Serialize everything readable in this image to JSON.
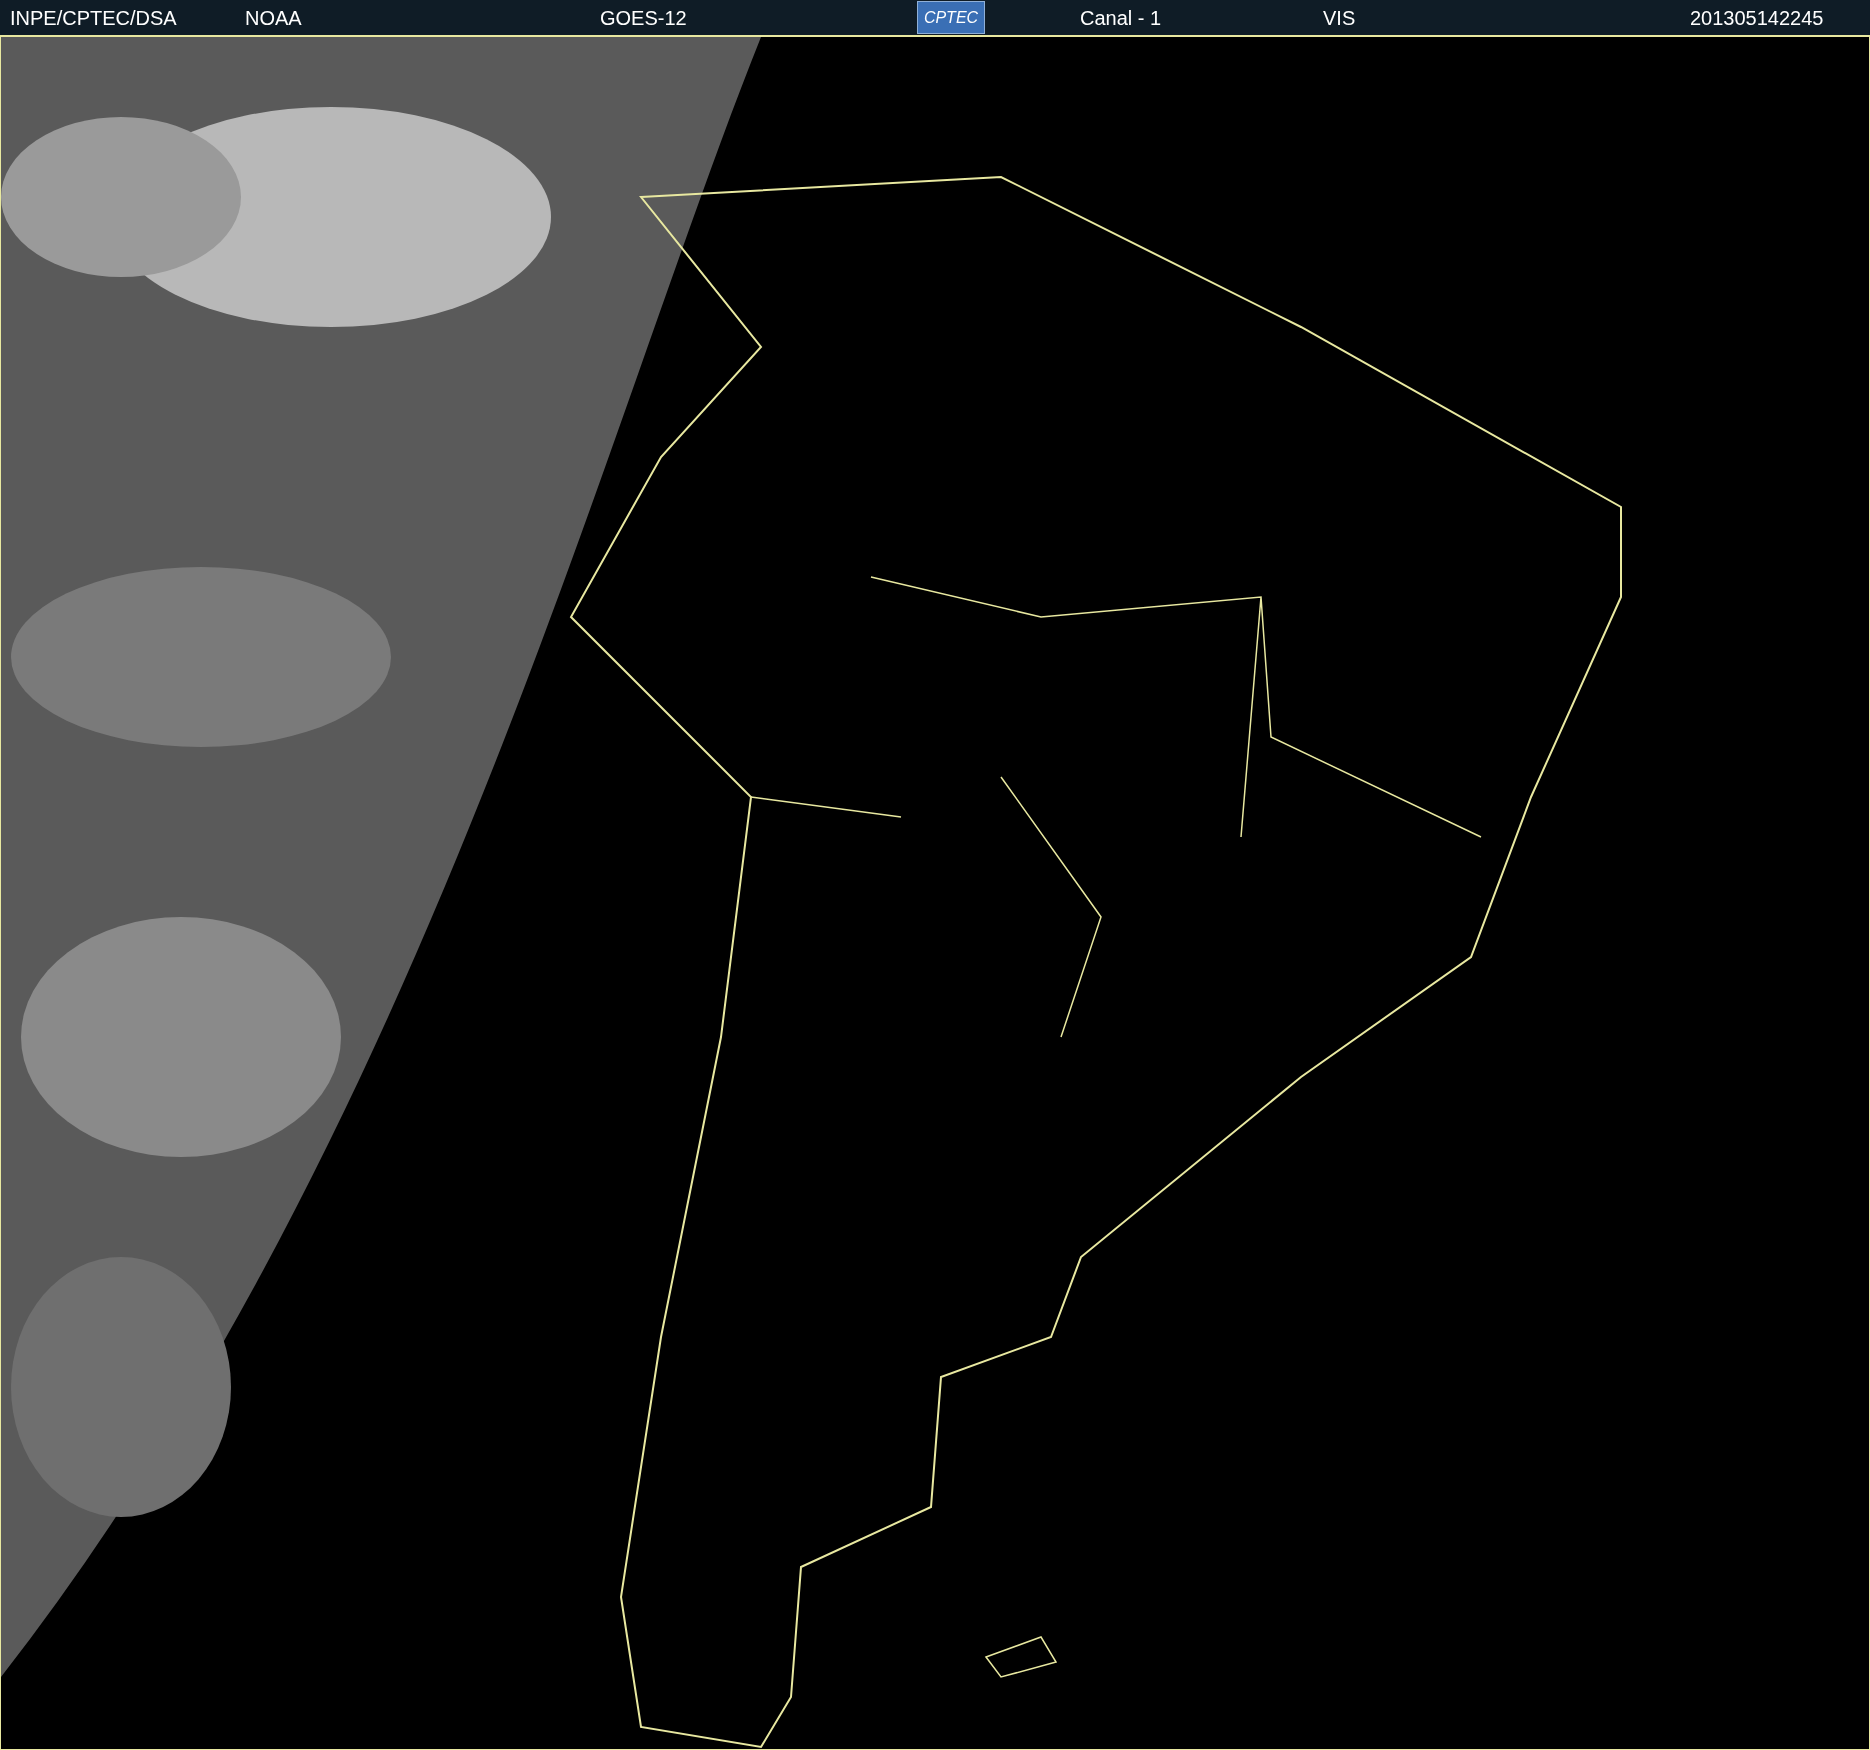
{
  "header": {
    "items": [
      "INPE/CPTEC/DSA",
      "NOAA",
      "GOES-12"
    ],
    "logo": "CPTEC",
    "right_items": [
      "Canal - 1",
      "VIS",
      "201305142245"
    ]
  }
}
